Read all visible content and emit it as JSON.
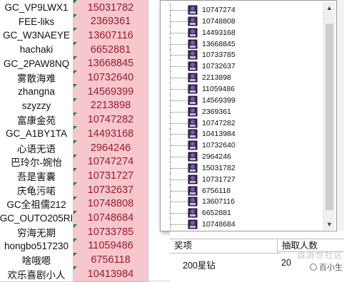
{
  "sheet": {
    "rows": [
      {
        "name": "GC_VP9LWX1",
        "value": "15031782"
      },
      {
        "name": "FEE-liks",
        "value": "2369361"
      },
      {
        "name": "GC_W3NAEYE",
        "value": "13607116"
      },
      {
        "name": "hachaki",
        "value": "6652881"
      },
      {
        "name": "GC_2PAW8NQ",
        "value": "13668845"
      },
      {
        "name": "雾散海难",
        "value": "10732640"
      },
      {
        "name": "zhangna",
        "value": "14569399"
      },
      {
        "name": "szyzzy",
        "value": "2213898"
      },
      {
        "name": "富康金苑",
        "value": "10747282"
      },
      {
        "name": "GC_A1BY1TA",
        "value": "14493168"
      },
      {
        "name": "心语无语",
        "value": "2964246"
      },
      {
        "name": "巴玲尔-婉怡",
        "value": "10747274"
      },
      {
        "name": "吾是害囊",
        "value": "10731727"
      },
      {
        "name": "庆龟污喏",
        "value": "10732637"
      },
      {
        "name": "GC全祖儒212",
        "value": "10748808"
      },
      {
        "name": "GC_OUTO205RI",
        "value": "10748684"
      },
      {
        "name": "穷海无期",
        "value": "10733785"
      },
      {
        "name": "hongbo517230",
        "value": "11059486"
      },
      {
        "name": "啥哦嗯",
        "value": "6756118"
      },
      {
        "name": "欢乐喜剧小人",
        "value": "10413984"
      }
    ]
  },
  "popup": {
    "items": [
      "10747274",
      "10748808",
      "14493168",
      "13668845",
      "10733785",
      "10732637",
      "2213898",
      "11059486",
      "14569399",
      "2369361",
      "10747282",
      "10413984",
      "10732640",
      "2964246",
      "15031782",
      "10731727",
      "6756118",
      "13607116",
      "6652881",
      "10748684"
    ],
    "scroll_up": "▲",
    "scroll_down": "▼"
  },
  "table": {
    "col1_header": "奖项",
    "col2_header": "抽取人数",
    "prize": "200星钻",
    "count": "20"
  },
  "watermark": {
    "line1": "盘游世社区",
    "line2": "百小生"
  }
}
